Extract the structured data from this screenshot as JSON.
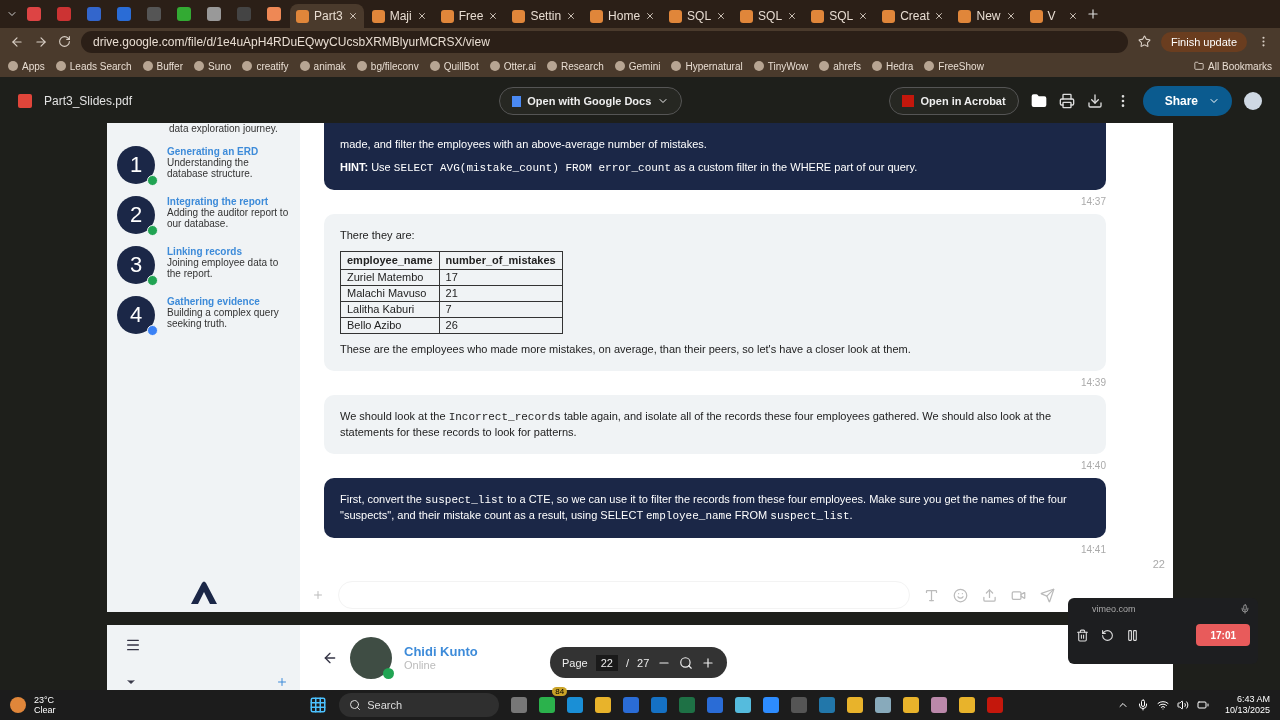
{
  "browser": {
    "tabs": [
      {
        "title": "Part3",
        "selected": true
      },
      {
        "title": "Maji",
        "selected": false
      },
      {
        "title": "Free",
        "selected": false
      },
      {
        "title": "Settin",
        "selected": false
      },
      {
        "title": "Home",
        "selected": false
      },
      {
        "title": "SQL",
        "selected": false
      },
      {
        "title": "SQL",
        "selected": false
      },
      {
        "title": "SQL",
        "selected": false
      },
      {
        "title": "Creat",
        "selected": false
      },
      {
        "title": "New",
        "selected": false
      },
      {
        "title": "V",
        "selected": false
      }
    ],
    "url": "drive.google.com/file/d/1e4uApH4RDuEQwyCUcsbXRMBlyurMCRSX/view",
    "update_button": "Finish update",
    "bookmarks": [
      "Apps",
      "Leads Search",
      "Buffer",
      "Suno",
      "creatify",
      "animak",
      "bg/fileconv",
      "QuillBot",
      "Otter.ai",
      "Research",
      "Gemini",
      "Hypernatural",
      "TinyWow",
      "ahrefs",
      "Hedra",
      "FreeShow"
    ],
    "all_bookmarks": "All Bookmarks"
  },
  "viewer": {
    "file_name": "Part3_Slides.pdf",
    "open_with": "Open with Google Docs",
    "open_acrobat": "Open in Acrobat",
    "share": "Share"
  },
  "slide": {
    "sidebar": {
      "intro_tail": "data exploration journey.",
      "steps": [
        {
          "number": "1",
          "title": "Generating an ERD",
          "description": "Understanding the database structure.",
          "color": "#21a453"
        },
        {
          "number": "2",
          "title": "Integrating the report",
          "description": "Adding the auditor report to our database.",
          "color": "#21a453"
        },
        {
          "number": "3",
          "title": "Linking records",
          "description": "Joining employee data to the report.",
          "color": "#21a453"
        },
        {
          "number": "4",
          "title": "Gathering evidence",
          "description": "Building a complex query seeking truth.",
          "color": "#3b82f6"
        }
      ]
    },
    "messages": [
      {
        "kind": "dark",
        "time": "14:37",
        "blocks": [
          {
            "kind": "paragraph",
            "parts": [
              {
                "kind": "text",
                "text": "made, and filter the employees with an above-average number of mistakes."
              }
            ]
          },
          {
            "kind": "paragraph",
            "parts": [
              {
                "kind": "text",
                "text": "**HINT:** Use "
              },
              {
                "kind": "code",
                "text": "SELECT AVG(mistake_count) FROM error_count"
              },
              {
                "kind": "text",
                "text": " as a custom filter in the WHERE part of our query."
              }
            ]
          }
        ]
      },
      {
        "kind": "light",
        "time": "14:39",
        "blocks": [
          {
            "kind": "paragraph",
            "parts": [
              {
                "kind": "text",
                "text": "There they are:"
              }
            ]
          },
          {
            "kind": "table",
            "columns": [
              "employee_name",
              "number_of_mistakes"
            ],
            "rows": [
              [
                "Zuriel Matembo",
                "17"
              ],
              [
                "Malachi Mavuso",
                "21"
              ],
              [
                "Lalitha Kaburi",
                "7"
              ],
              [
                "Bello Azibo",
                "26"
              ]
            ]
          },
          {
            "kind": "paragraph",
            "parts": [
              {
                "kind": "text",
                "text": "These are the employees who made more mistakes, on average, than their peers, so let's have a closer look at them."
              }
            ]
          }
        ]
      },
      {
        "kind": "light",
        "time": "14:40",
        "blocks": [
          {
            "kind": "paragraph",
            "parts": [
              {
                "kind": "text",
                "text": "We should look at the "
              },
              {
                "kind": "code",
                "text": "Incorrect_records"
              },
              {
                "kind": "text",
                "text": " table again, and isolate all of the records these four employees gathered. We should also look at the statements for these records to look for patterns."
              }
            ]
          }
        ]
      },
      {
        "kind": "dark",
        "time": "14:41",
        "blocks": [
          {
            "kind": "paragraph",
            "parts": [
              {
                "kind": "text",
                "text": "First, convert the "
              },
              {
                "kind": "code",
                "text": "suspect_list"
              },
              {
                "kind": "text",
                "text": " to a CTE, so we can use it to filter the records from these four employees. Make sure you get the names of the four \"suspects\", and their mistake count as a result, using SELECT "
              },
              {
                "kind": "code",
                "text": "employee_name"
              },
              {
                "kind": "text",
                "text": " FROM "
              },
              {
                "kind": "code",
                "text": "suspect_list"
              },
              {
                "kind": "text",
                "text": "."
              }
            ]
          }
        ]
      }
    ],
    "page_number": "22"
  },
  "next_slide": {
    "contact_name": "Chidi Kunto",
    "contact_status": "Online"
  },
  "page_control": {
    "label": "Page",
    "current": "22",
    "separator": "/",
    "total": "27"
  },
  "recorder": {
    "site": "vimeo.com",
    "time": "17:01"
  },
  "taskbar": {
    "temperature": "23°C",
    "weather": "Clear",
    "search": "Search",
    "badge": "84",
    "time": "6:43 AM",
    "date": "10/13/2025"
  }
}
